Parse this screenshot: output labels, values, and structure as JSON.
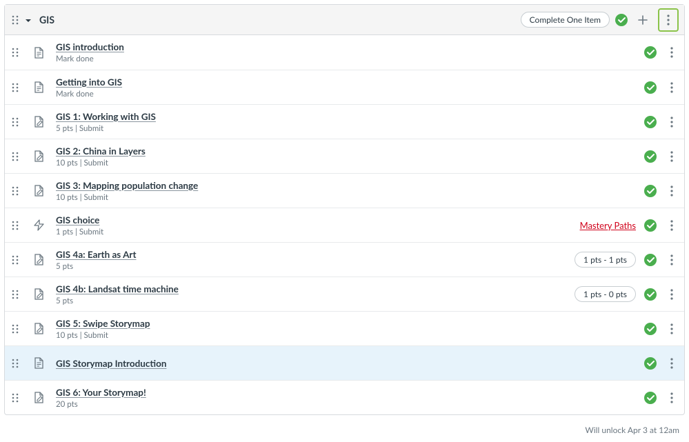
{
  "module": {
    "title": "GIS",
    "completion_pill": "Complete One Item",
    "footer": "Will unlock Apr 3 at 12am"
  },
  "items": [
    {
      "icon": "page",
      "title": "GIS introduction",
      "meta": "Mark done",
      "mastery": false,
      "badge": null,
      "selected": false
    },
    {
      "icon": "page",
      "title": "Getting into GIS",
      "meta": "Mark done",
      "mastery": false,
      "badge": null,
      "selected": false
    },
    {
      "icon": "assignment",
      "title": "GIS 1: Working with GIS",
      "meta": "5 pts  |  Submit",
      "mastery": false,
      "badge": null,
      "selected": false
    },
    {
      "icon": "assignment",
      "title": "GIS 2: China in Layers",
      "meta": "10 pts  |  Submit",
      "mastery": false,
      "badge": null,
      "selected": false
    },
    {
      "icon": "assignment",
      "title": "GIS 3: Mapping population change",
      "meta": "10 pts  |  Submit",
      "mastery": false,
      "badge": null,
      "selected": false
    },
    {
      "icon": "quiz",
      "title": "GIS choice",
      "meta": "1 pts  |  Submit",
      "mastery": true,
      "badge": null,
      "selected": false
    },
    {
      "icon": "assignment",
      "title": "GIS 4a: Earth as Art",
      "meta": "5 pts",
      "mastery": false,
      "badge": "1 pts - 1 pts",
      "selected": false
    },
    {
      "icon": "assignment",
      "title": "GIS 4b: Landsat time machine",
      "meta": "5 pts",
      "mastery": false,
      "badge": "1 pts - 0 pts",
      "selected": false
    },
    {
      "icon": "assignment",
      "title": "GIS 5: Swipe Storymap",
      "meta": "10 pts  |  Submit",
      "mastery": false,
      "badge": null,
      "selected": false
    },
    {
      "icon": "page",
      "title": "GIS Storymap Introduction",
      "meta": null,
      "mastery": false,
      "badge": null,
      "selected": true
    },
    {
      "icon": "assignment",
      "title": "GIS 6: Your Storymap!",
      "meta": "20 pts",
      "mastery": false,
      "badge": null,
      "selected": false
    }
  ],
  "labels": {
    "mastery_paths": "Mastery Paths"
  }
}
